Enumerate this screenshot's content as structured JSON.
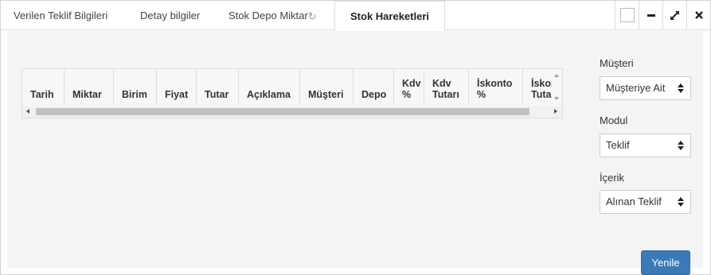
{
  "tabs": [
    {
      "label": "Verilen Teklif Bilgileri"
    },
    {
      "label": "Detay bilgiler"
    },
    {
      "label": "Stok Depo Miktar"
    },
    {
      "label": "Stok Hareketleri"
    }
  ],
  "icons": {
    "refresh": "refresh-icon",
    "maximize": "maximize-icon",
    "minimize": "minimize-icon",
    "expand": "expand-icon",
    "close": "close-icon"
  },
  "grid": {
    "columns": [
      {
        "label": "Tarih"
      },
      {
        "label": "Miktar"
      },
      {
        "label": "Birim"
      },
      {
        "label": "Fiyat"
      },
      {
        "label": "Tutar"
      },
      {
        "label": "Açıklama"
      },
      {
        "label": "Müşteri"
      },
      {
        "label": "Depo"
      },
      {
        "label": "Kdv %"
      },
      {
        "label": "Kdv Tutarı"
      },
      {
        "label": "İskonto %"
      },
      {
        "label": "İskonto Tutarı"
      }
    ]
  },
  "filters": {
    "musteri": {
      "label": "Müşteri",
      "value": "Müşteriye Ait"
    },
    "modul": {
      "label": "Modul",
      "value": "Teklif"
    },
    "icerik": {
      "label": "İçerik",
      "value": "Alınan Teklif"
    }
  },
  "actions": {
    "refresh_label": "Yenile"
  },
  "colors": {
    "primary_button": "#3b79b7",
    "content_bg": "#f4f4f4"
  }
}
